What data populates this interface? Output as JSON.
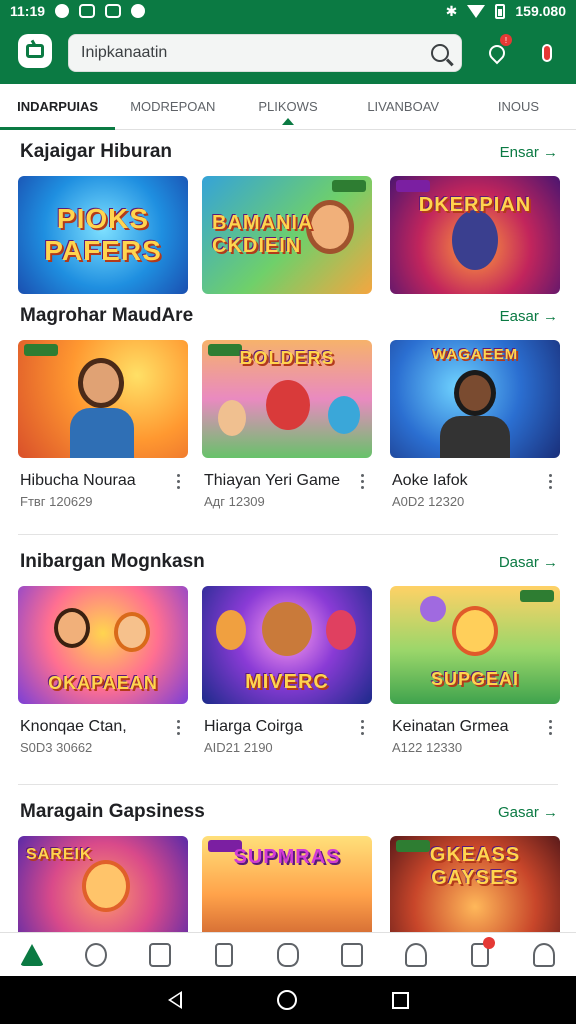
{
  "status_bar": {
    "time": "11:19",
    "right_time": "159.080"
  },
  "search": {
    "value": "Inipkanaatin"
  },
  "tabs": [
    {
      "label": "INDARPUIAS",
      "active": true
    },
    {
      "label": "MODREPOAN"
    },
    {
      "label": "PLIKOWS"
    },
    {
      "label": "LIVANBOAV"
    },
    {
      "label": "INOUS"
    }
  ],
  "sections": [
    {
      "title": "Kajaigar Hiburan",
      "more": "Ensar",
      "cards": [
        {
          "thumb_text": "PIOKS PAFERS"
        },
        {
          "thumb_text": "BAMANIA CKDIEIN"
        },
        {
          "thumb_text": "DKERPIAN"
        }
      ]
    },
    {
      "title": "Magrohar MaudAre",
      "more": "Easar",
      "cards": [
        {
          "title": "Hibucha Nouraa",
          "sub": "Fтвг 120629"
        },
        {
          "title": "Thiayan Yeri Game",
          "sub": "Aдг 12309",
          "thumb_text": "BOLDERS"
        },
        {
          "title": "Aoke Iafok",
          "sub": "A0D2 12320",
          "thumb_text": "WAGAEEM"
        }
      ]
    },
    {
      "title": "Inibargan Mognkasn",
      "more": "Dasar",
      "cards": [
        {
          "title": "Knonqae Ctan,",
          "sub": "S0D3 30662",
          "thumb_text": "OKAPAEAN"
        },
        {
          "title": "Hiarga Coirga",
          "sub": "AID21 2190",
          "thumb_text": "MIVERC"
        },
        {
          "title": "Keinatan Grmea",
          "sub": "A122 12330",
          "thumb_text": "SUPGEAI"
        }
      ]
    },
    {
      "title": "Maragain Gapsiness",
      "more": "Gasar",
      "cards": [
        {
          "thumb_text": "SAREIK"
        },
        {
          "thumb_text": "SUPMRAS"
        },
        {
          "thumb_text": "GKEASS GAYSES"
        }
      ]
    }
  ],
  "bottom_nav": [
    "home-icon",
    "person-badge-icon",
    "store-icon",
    "clipboard-icon",
    "chat-icon",
    "calendar-icon",
    "triangle-a-icon",
    "tablet-notification-icon",
    "profile-icon"
  ],
  "colors": {
    "primary": "#0b7a43",
    "badge": "#e53935"
  }
}
